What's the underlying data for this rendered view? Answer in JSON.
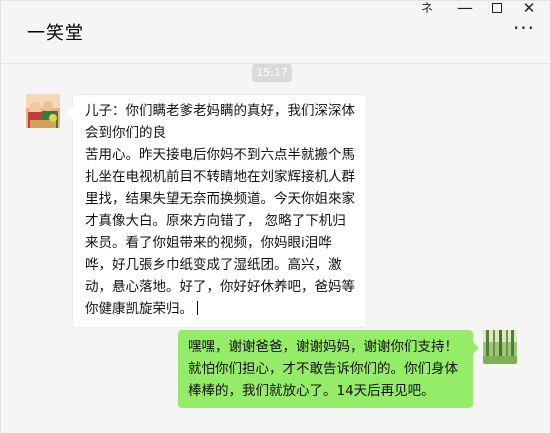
{
  "window": {
    "title": "一笑堂",
    "controls": {
      "pin": "ネ",
      "minimize": "—",
      "maximize": "□",
      "close": "✕"
    },
    "more": "···"
  },
  "chat": {
    "timestamp": "15:17",
    "messages": [
      {
        "side": "left",
        "text": "儿子：你们瞒老爹老妈瞒的真好，我们深深体会到你们的良\n苦用心。昨天接电后你妈不到六点半就搬个馬扎坐在电视机前目不转睛地在刘家辉接机人群里找，结果失望无奈而换频道。今天你姐來家才真像大白。原來方向错了， 忽略了下机归来员。看了你姐带来的视频，你妈眼i泪哗哗，好几張乡巾纸变成了湿纸团。高兴，激动，悬心落地。好了，你好好休养吧，爸妈等你健康凯旋荣归。"
      },
      {
        "side": "right",
        "text": "嘿嘿，谢谢爸爸，谢谢妈妈，谢谢你们支持！ 就怕你们担心，才不敢告诉你们的。你们身体棒棒的，我们就放心了。14天后再见吧。"
      }
    ]
  },
  "colors": {
    "background": "#f5f5f5",
    "incoming_bubble": "#ffffff",
    "outgoing_bubble": "#95ec69",
    "timestamp_bg": "#dadada"
  }
}
